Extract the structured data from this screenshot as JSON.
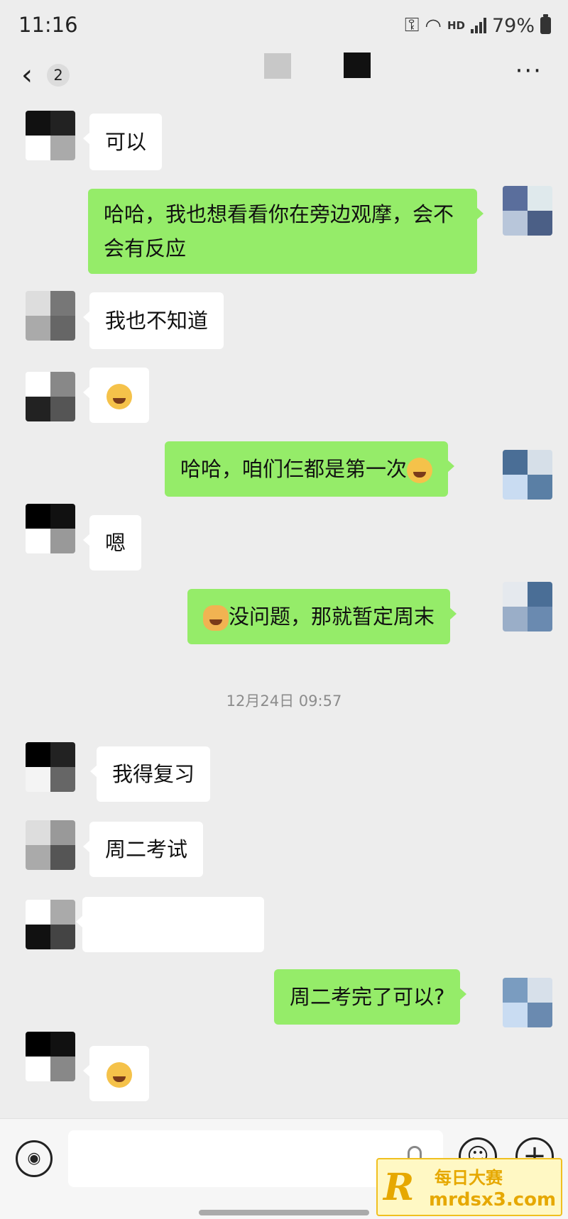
{
  "status_bar": {
    "time": "11:16",
    "hd": "HD",
    "battery": "79%"
  },
  "nav": {
    "back_count": "2"
  },
  "messages": [
    {
      "side": "left",
      "text": "可以"
    },
    {
      "side": "right",
      "text": "哈哈，我也想看看你在旁边观摩，会不会有反应"
    },
    {
      "side": "left",
      "text": "我也不知道"
    },
    {
      "side": "left",
      "emoji": "laugh-cry-emoji"
    },
    {
      "side": "right",
      "text": "哈哈，咱们仨都是第一次"
    },
    {
      "side": "left",
      "text": "嗯"
    },
    {
      "side": "right",
      "text": "没问题，那就暂定周末"
    },
    {
      "side": "left",
      "text": "我得复习"
    },
    {
      "side": "left",
      "text": "周二考试"
    },
    {
      "side": "left",
      "text": ""
    },
    {
      "side": "right",
      "text": "周二考完了可以?"
    },
    {
      "side": "left",
      "emoji": "laugh-cry-emoji"
    }
  ],
  "timestamp": "12月24日 09:57",
  "input": {
    "placeholder": ""
  },
  "watermark": {
    "logo": "R",
    "name": "每日大赛",
    "url": "mrdsx3.com"
  },
  "colors": {
    "background": "#ededed",
    "sent_bubble": "#95ec69",
    "received_bubble": "#ffffff"
  }
}
